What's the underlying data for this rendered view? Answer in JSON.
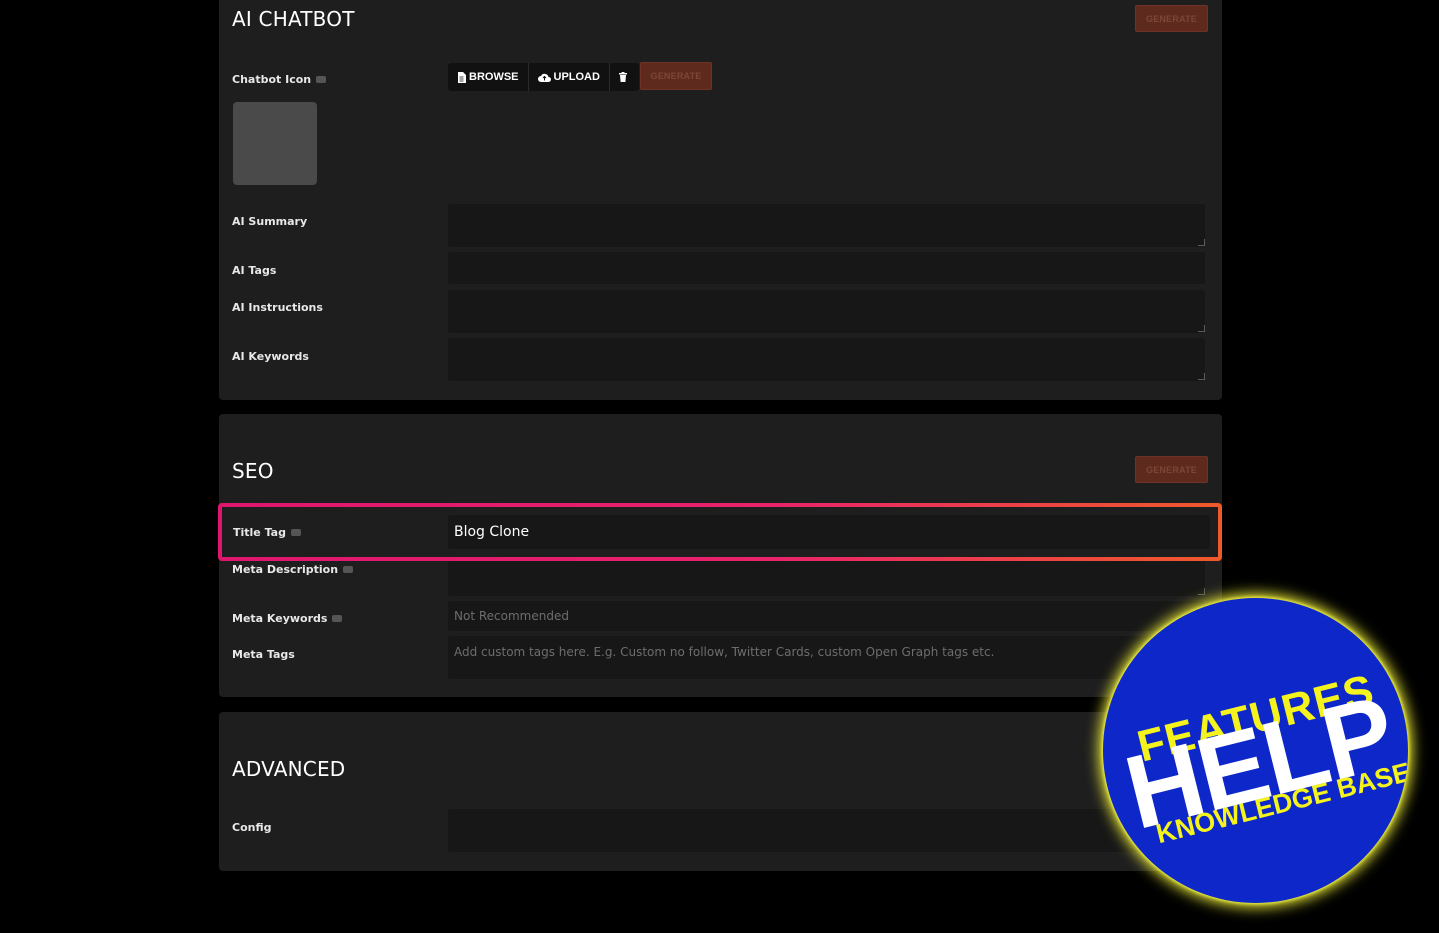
{
  "chatbot": {
    "title": "AI CHATBOT",
    "generate_label": "GENERATE",
    "icon_label": "Chatbot Icon",
    "browse_label": "BROWSE",
    "upload_label": "UPLOAD",
    "icon_generate_label": "GENERATE",
    "summary_label": "AI Summary",
    "tags_label": "AI Tags",
    "instructions_label": "AI Instructions",
    "keywords_label": "AI Keywords"
  },
  "seo": {
    "title": "SEO",
    "generate_label": "GENERATE",
    "title_tag_label": "Title Tag",
    "title_tag_value": "Blog Clone",
    "meta_description_label": "Meta Description",
    "meta_keywords_label": "Meta Keywords",
    "meta_keywords_placeholder": "Not Recommended",
    "meta_tags_label": "Meta Tags",
    "meta_tags_placeholder": "Add custom tags here. E.g. Custom no follow, Twitter Cards, custom Open Graph tags etc."
  },
  "advanced": {
    "title": "ADVANCED",
    "config_label": "Config"
  },
  "badge": {
    "line1": "FEATURES",
    "line2": "HELP",
    "line3": "KNOWLEDGE BASE"
  },
  "colors": {
    "highlight_start": "#e0156f",
    "highlight_end": "#f05a2a",
    "badge_bg": "#0d27c9",
    "badge_glow": "#f2f23a"
  }
}
